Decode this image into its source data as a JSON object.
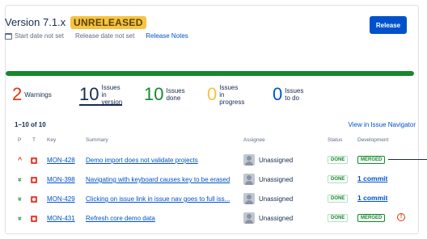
{
  "header": {
    "version": "Version 7.1.x",
    "status_badge": "UNRELEASED",
    "start_date": "Start date not set",
    "release_date": "Release date not set",
    "release_notes": "Release Notes",
    "release_button": "Release"
  },
  "progress": {
    "done_fraction": 1.0
  },
  "stats": [
    {
      "number": "2",
      "label_line1": "Warnings",
      "label_line2": "",
      "color": "#de350b"
    },
    {
      "number": "10",
      "label_line1": "Issues in",
      "label_line2": "version",
      "color": "#172b4d"
    },
    {
      "number": "10",
      "label_line1": "Issues",
      "label_line2": "done",
      "color": "#14892c"
    },
    {
      "number": "0",
      "label_line1": "Issues",
      "label_line2": "in progress",
      "color": "#f6c342"
    },
    {
      "number": "0",
      "label_line1": "Issues",
      "label_line2": "to do",
      "color": "#0052cc"
    }
  ],
  "table": {
    "count": "1–10 of 10",
    "view_link": "View in Issue Navigator",
    "columns": [
      "P",
      "T",
      "Key",
      "Summary",
      "Assignee",
      "Status",
      "Development"
    ],
    "rows": [
      {
        "priority": "^",
        "key": "MON-428",
        "summary": "Demo import does not validate projects",
        "assignee": "Unassigned",
        "status": "DONE",
        "development": "MERGED",
        "dev_type": "merged",
        "warning": false
      },
      {
        "priority": "»",
        "key": "MON-398",
        "summary": "Navigating with keyboard causes key to be erased",
        "assignee": "Unassigned",
        "status": "DONE",
        "development": "1 commit",
        "dev_type": "commit",
        "warning": false
      },
      {
        "priority": "»",
        "key": "MON-429",
        "summary": "Clicking on issue link in issue nav goes to full iss...",
        "assignee": "Unassigned",
        "status": "DONE",
        "development": "1 commit",
        "dev_type": "commit",
        "warning": false
      },
      {
        "priority": "»",
        "key": "MON-431",
        "summary": "Refresh core demo data",
        "assignee": "Unassigned",
        "status": "DONE",
        "development": "MERGED",
        "dev_type": "merged",
        "warning": true,
        "warning_icon": "!"
      }
    ]
  },
  "colors": {
    "accent": "#0052cc",
    "done": "#14892c",
    "badge": "#f6c342",
    "priority_high": "#de350b",
    "priority_low": "#14892c"
  }
}
